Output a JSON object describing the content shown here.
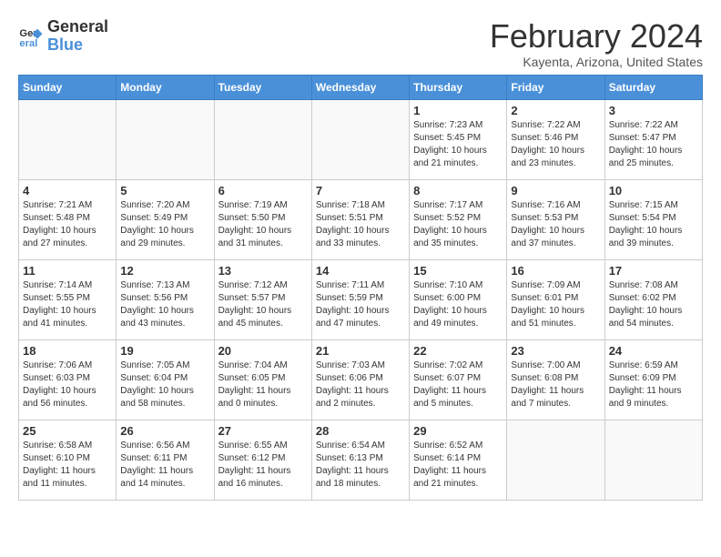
{
  "logo": {
    "text_general": "General",
    "text_blue": "Blue"
  },
  "header": {
    "month": "February 2024",
    "location": "Kayenta, Arizona, United States"
  },
  "days_of_week": [
    "Sunday",
    "Monday",
    "Tuesday",
    "Wednesday",
    "Thursday",
    "Friday",
    "Saturday"
  ],
  "weeks": [
    [
      {
        "day": "",
        "info": ""
      },
      {
        "day": "",
        "info": ""
      },
      {
        "day": "",
        "info": ""
      },
      {
        "day": "",
        "info": ""
      },
      {
        "day": "1",
        "info": "Sunrise: 7:23 AM\nSunset: 5:45 PM\nDaylight: 10 hours\nand 21 minutes."
      },
      {
        "day": "2",
        "info": "Sunrise: 7:22 AM\nSunset: 5:46 PM\nDaylight: 10 hours\nand 23 minutes."
      },
      {
        "day": "3",
        "info": "Sunrise: 7:22 AM\nSunset: 5:47 PM\nDaylight: 10 hours\nand 25 minutes."
      }
    ],
    [
      {
        "day": "4",
        "info": "Sunrise: 7:21 AM\nSunset: 5:48 PM\nDaylight: 10 hours\nand 27 minutes."
      },
      {
        "day": "5",
        "info": "Sunrise: 7:20 AM\nSunset: 5:49 PM\nDaylight: 10 hours\nand 29 minutes."
      },
      {
        "day": "6",
        "info": "Sunrise: 7:19 AM\nSunset: 5:50 PM\nDaylight: 10 hours\nand 31 minutes."
      },
      {
        "day": "7",
        "info": "Sunrise: 7:18 AM\nSunset: 5:51 PM\nDaylight: 10 hours\nand 33 minutes."
      },
      {
        "day": "8",
        "info": "Sunrise: 7:17 AM\nSunset: 5:52 PM\nDaylight: 10 hours\nand 35 minutes."
      },
      {
        "day": "9",
        "info": "Sunrise: 7:16 AM\nSunset: 5:53 PM\nDaylight: 10 hours\nand 37 minutes."
      },
      {
        "day": "10",
        "info": "Sunrise: 7:15 AM\nSunset: 5:54 PM\nDaylight: 10 hours\nand 39 minutes."
      }
    ],
    [
      {
        "day": "11",
        "info": "Sunrise: 7:14 AM\nSunset: 5:55 PM\nDaylight: 10 hours\nand 41 minutes."
      },
      {
        "day": "12",
        "info": "Sunrise: 7:13 AM\nSunset: 5:56 PM\nDaylight: 10 hours\nand 43 minutes."
      },
      {
        "day": "13",
        "info": "Sunrise: 7:12 AM\nSunset: 5:57 PM\nDaylight: 10 hours\nand 45 minutes."
      },
      {
        "day": "14",
        "info": "Sunrise: 7:11 AM\nSunset: 5:59 PM\nDaylight: 10 hours\nand 47 minutes."
      },
      {
        "day": "15",
        "info": "Sunrise: 7:10 AM\nSunset: 6:00 PM\nDaylight: 10 hours\nand 49 minutes."
      },
      {
        "day": "16",
        "info": "Sunrise: 7:09 AM\nSunset: 6:01 PM\nDaylight: 10 hours\nand 51 minutes."
      },
      {
        "day": "17",
        "info": "Sunrise: 7:08 AM\nSunset: 6:02 PM\nDaylight: 10 hours\nand 54 minutes."
      }
    ],
    [
      {
        "day": "18",
        "info": "Sunrise: 7:06 AM\nSunset: 6:03 PM\nDaylight: 10 hours\nand 56 minutes."
      },
      {
        "day": "19",
        "info": "Sunrise: 7:05 AM\nSunset: 6:04 PM\nDaylight: 10 hours\nand 58 minutes."
      },
      {
        "day": "20",
        "info": "Sunrise: 7:04 AM\nSunset: 6:05 PM\nDaylight: 11 hours\nand 0 minutes."
      },
      {
        "day": "21",
        "info": "Sunrise: 7:03 AM\nSunset: 6:06 PM\nDaylight: 11 hours\nand 2 minutes."
      },
      {
        "day": "22",
        "info": "Sunrise: 7:02 AM\nSunset: 6:07 PM\nDaylight: 11 hours\nand 5 minutes."
      },
      {
        "day": "23",
        "info": "Sunrise: 7:00 AM\nSunset: 6:08 PM\nDaylight: 11 hours\nand 7 minutes."
      },
      {
        "day": "24",
        "info": "Sunrise: 6:59 AM\nSunset: 6:09 PM\nDaylight: 11 hours\nand 9 minutes."
      }
    ],
    [
      {
        "day": "25",
        "info": "Sunrise: 6:58 AM\nSunset: 6:10 PM\nDaylight: 11 hours\nand 11 minutes."
      },
      {
        "day": "26",
        "info": "Sunrise: 6:56 AM\nSunset: 6:11 PM\nDaylight: 11 hours\nand 14 minutes."
      },
      {
        "day": "27",
        "info": "Sunrise: 6:55 AM\nSunset: 6:12 PM\nDaylight: 11 hours\nand 16 minutes."
      },
      {
        "day": "28",
        "info": "Sunrise: 6:54 AM\nSunset: 6:13 PM\nDaylight: 11 hours\nand 18 minutes."
      },
      {
        "day": "29",
        "info": "Sunrise: 6:52 AM\nSunset: 6:14 PM\nDaylight: 11 hours\nand 21 minutes."
      },
      {
        "day": "",
        "info": ""
      },
      {
        "day": "",
        "info": ""
      }
    ]
  ]
}
